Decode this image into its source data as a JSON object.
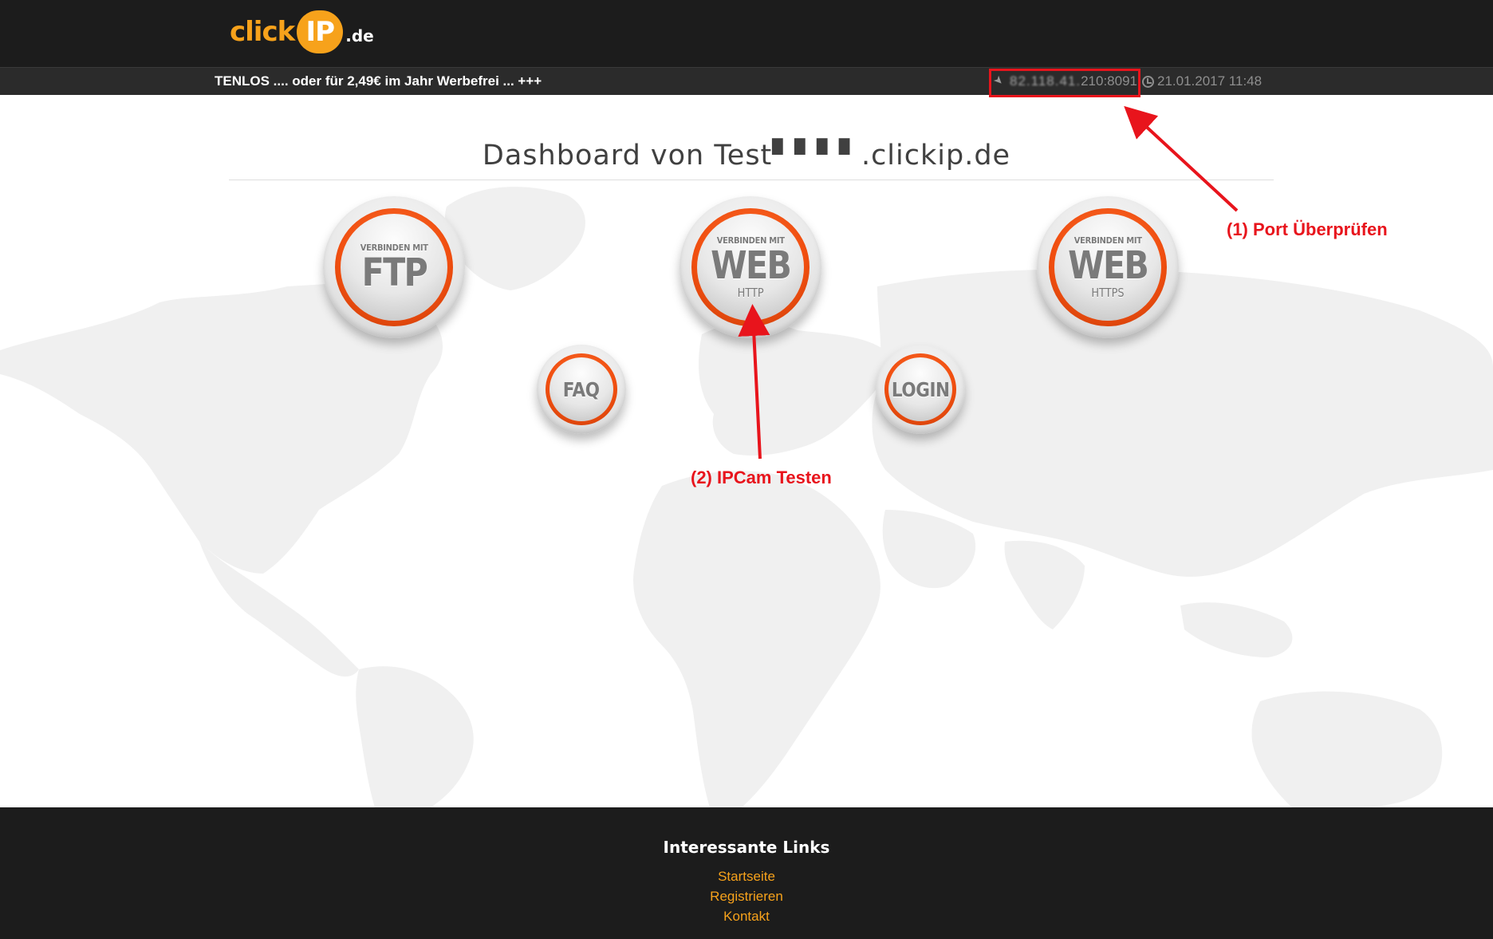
{
  "header": {
    "logo": {
      "click": "click",
      "ip": "IP",
      "tld": ".de"
    },
    "ticker": "TENLOS .... oder für 2,49€ im Jahr Werbefrei ... +++",
    "ip_masked": "82.118.41.",
    "ip_suffix": "210:8091",
    "datetime": "21.01.2017 11:48"
  },
  "main": {
    "title": "Dashboard von Test▘▘▘▘.clickip.de",
    "buttons": {
      "ftp": {
        "top": "VERBINDEN MIT",
        "main": "FTP",
        "sub": ""
      },
      "web_http": {
        "top": "VERBINDEN MIT",
        "main": "WEB",
        "sub": "HTTP"
      },
      "web_https": {
        "top": "VERBINDEN MIT",
        "main": "WEB",
        "sub": "HTTPS"
      },
      "faq": {
        "main": "FAQ"
      },
      "login": {
        "main": "LOGIN"
      }
    }
  },
  "annotations": {
    "port_check": "(1) Port Überprüfen",
    "ipcam_test": "(2) IPCam Testen"
  },
  "footer": {
    "heading": "Interessante Links",
    "links": [
      "Startseite",
      "Registrieren",
      "Kontakt"
    ]
  },
  "colors": {
    "accent": "#f7a21b",
    "button_ring": "#f04e0f",
    "annotation": "#e8141c",
    "dark_bg": "#1c1c1c"
  }
}
